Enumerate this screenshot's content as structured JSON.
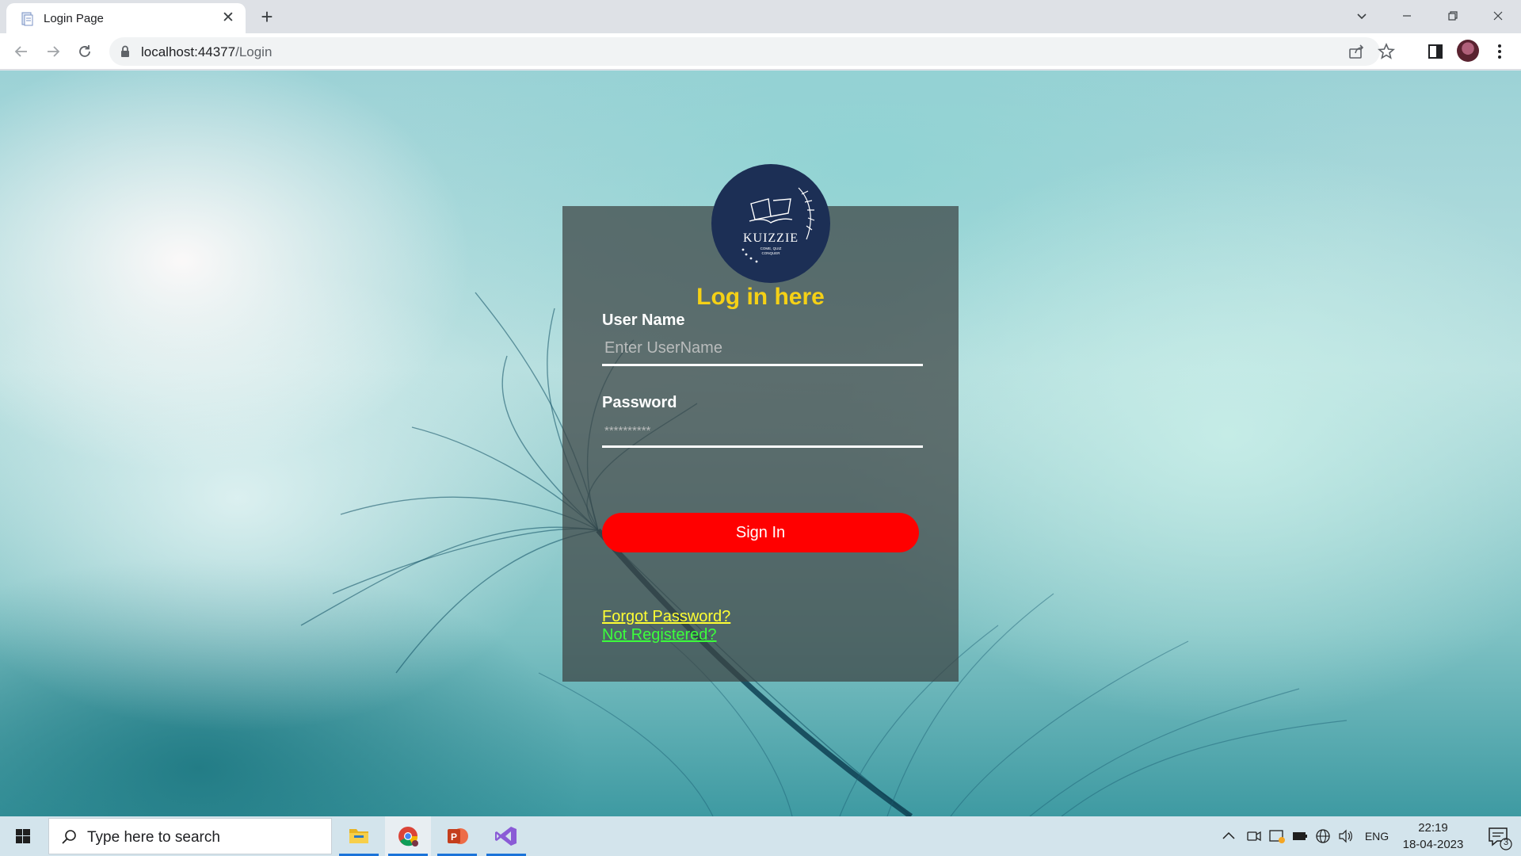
{
  "browser": {
    "tab_title": "Login Page",
    "url_host": "localhost:44377",
    "url_path": "/Login"
  },
  "login": {
    "logo_text": "KUIZZIE",
    "logo_tagline_1": "COME, QUIZ",
    "logo_tagline_2": "CONQUER",
    "title": "Log in here",
    "username_label": "User Name",
    "username_placeholder": "Enter UserName",
    "password_label": "Password",
    "password_placeholder": "**********",
    "signin_label": "Sign In",
    "forgot_link": "Forgot Password?",
    "register_link": "Not Registered?"
  },
  "taskbar": {
    "search_placeholder": "Type here to search",
    "language": "ENG",
    "time": "22:19",
    "date": "18-04-2023",
    "notification_count": "3"
  },
  "colors": {
    "title": "#f5d116",
    "signin_button": "#ff0000",
    "forgot_link": "#ffff33",
    "register_link": "#3cff3c",
    "logo_bg": "#1c2f55"
  }
}
